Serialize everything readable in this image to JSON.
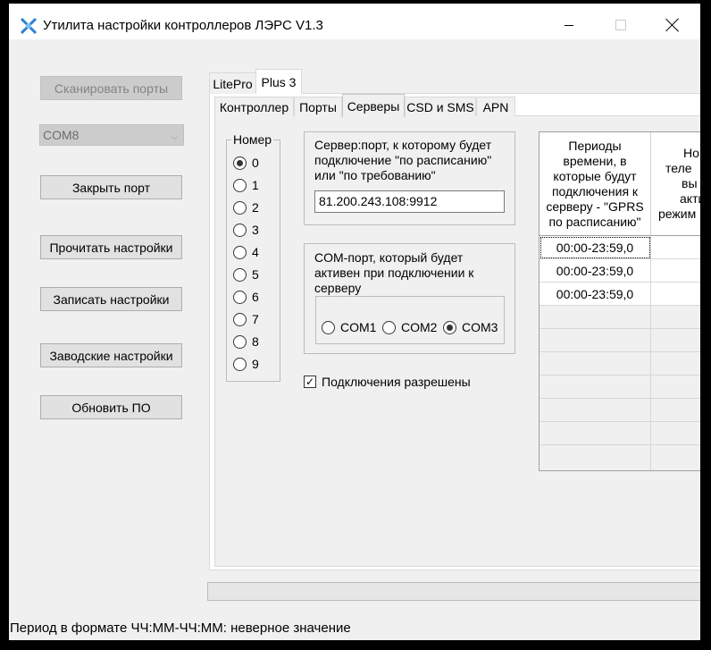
{
  "window": {
    "title": "Утилита настройки контроллеров ЛЭРС V1.3"
  },
  "left_panel": {
    "scan_ports": "Сканировать порты",
    "port_select_value": "COM8",
    "close_port": "Закрыть порт",
    "read_settings": "Прочитать настройки",
    "write_settings": "Записать настройки",
    "factory_settings": "Заводские настройки",
    "update_firmware": "Обновить ПО"
  },
  "device_tabs": [
    "LitePro",
    "Plus 3"
  ],
  "sub_tabs": [
    "Контроллер",
    "Порты",
    "Серверы",
    "CSD и SMS",
    "APN"
  ],
  "servers": {
    "number_group_label": "Номер",
    "numbers": [
      "0",
      "1",
      "2",
      "3",
      "4",
      "5",
      "6",
      "7",
      "8",
      "9"
    ],
    "selected_number": "0",
    "server_port_label_1": "Сервер:порт, к которому будет",
    "server_port_label_2": "подключение \"по расписанию\"",
    "server_port_label_3": "или \"по требованию\"",
    "server_port_value": "81.200.243.108:9912",
    "com_label_1": "COM-порт, который будет",
    "com_label_2": "активен при подключении к",
    "com_label_3": "серверу",
    "com_options": [
      "COM1",
      "COM2",
      "COM3"
    ],
    "com_selected": "COM3",
    "connections_allowed_label": "Подключения разрешены",
    "connections_allowed": true
  },
  "schedule_table": {
    "col1_header": [
      "Периоды",
      "времени, в",
      "которые будут",
      "подключения к",
      "серверу - \"GPRS",
      "по расписанию\""
    ],
    "col2_header": [
      "Но",
      "теле",
      "вы",
      "акти",
      "акти",
      "режим"
    ],
    "rows": [
      "00:00-23:59,0",
      "00:00-23:59,0",
      "00:00-23:59,0",
      "",
      "",
      "",
      "",
      "",
      ""
    ]
  },
  "status_bar": {
    "text": "Период в формате ЧЧ:ММ-ЧЧ:ММ: неверное значение"
  },
  "colors": {
    "accent_icon": "#2a7fd4",
    "window_bg": "#f0f0f0",
    "button_bg": "#e1e1e1"
  }
}
